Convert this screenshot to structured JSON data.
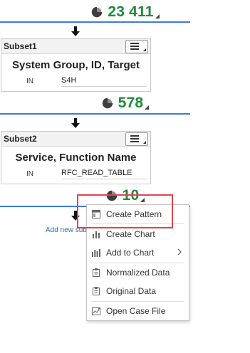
{
  "steps": [
    {
      "count": "23 411"
    },
    {
      "count": "578"
    },
    {
      "count": "10"
    }
  ],
  "subsets": [
    {
      "name": "Subset1",
      "title": "System Group, ID, Target",
      "operator": "IN",
      "value": "S4H"
    },
    {
      "name": "Subset2",
      "title": "Service, Function Name",
      "operator": "IN",
      "value": "RFC_READ_TABLE"
    }
  ],
  "add_subset_link": "Add new sub",
  "context_menu": {
    "items": [
      {
        "label": "Create Pattern",
        "icon": "pattern-icon"
      },
      {
        "label": "Create Chart",
        "icon": "bar-chart-icon"
      },
      {
        "label": "Add to Chart",
        "icon": "bar-chart-add-icon",
        "submenu": true
      },
      {
        "label": "Normalized Data",
        "icon": "clipboard-icon"
      },
      {
        "label": "Original Data",
        "icon": "clipboard-icon"
      },
      {
        "label": "Open Case File",
        "icon": "case-file-icon"
      }
    ]
  },
  "colors": {
    "count_green": "#1e8a3c",
    "divider_blue": "#3b7dd8",
    "highlight_red": "#e0444e",
    "link_blue": "#2a6db3"
  }
}
